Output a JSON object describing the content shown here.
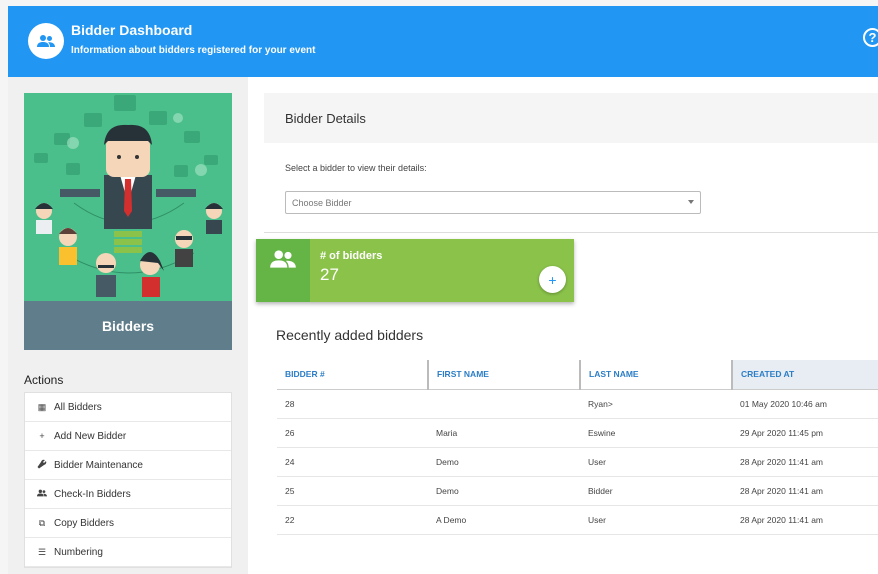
{
  "header": {
    "title": "Bidder Dashboard",
    "subtitle": "Information about bidders registered for your event",
    "help_glyph": "?",
    "icon": "people-icon"
  },
  "hero": {
    "caption": "Bidders"
  },
  "actions": {
    "title": "Actions",
    "items": [
      {
        "label": "All Bidders",
        "icon": "grid-icon",
        "glyph": "▦"
      },
      {
        "label": "Add New Bidder",
        "icon": "plus-icon",
        "glyph": "+"
      },
      {
        "label": "Bidder Maintenance",
        "icon": "wrench-icon",
        "glyph": "🔧"
      },
      {
        "label": "Check-In Bidders",
        "icon": "people-icon",
        "glyph": "👥"
      },
      {
        "label": "Copy Bidders",
        "icon": "copy-icon",
        "glyph": "⧉"
      },
      {
        "label": "Numbering",
        "icon": "list-icon",
        "glyph": "☰"
      }
    ]
  },
  "details": {
    "title": "Bidder Details",
    "select_label": "Select a bidder to view their details:",
    "select_placeholder": "Choose Bidder"
  },
  "stat": {
    "label": "# of bidders",
    "value": "27",
    "plus": "+"
  },
  "recent": {
    "title": "Recently added bidders",
    "columns": [
      "BIDDER #",
      "FIRST NAME",
      "LAST NAME",
      "CREATED AT"
    ],
    "rows": [
      [
        "28",
        "",
        "Ryan>",
        "01 May 2020 10:46 am"
      ],
      [
        "26",
        "Maria",
        "Eswine",
        "29 Apr 2020 11:45 pm"
      ],
      [
        "24",
        "Demo",
        "User",
        "28 Apr 2020 11:41 am"
      ],
      [
        "25",
        "Demo",
        "Bidder",
        "28 Apr 2020 11:41 am"
      ],
      [
        "22",
        "A Demo",
        "User",
        "28 Apr 2020 11:41 am"
      ]
    ]
  },
  "colors": {
    "header": "#2196f3",
    "hero_bg": "#4bbf8b",
    "caption_bg": "#607d8b",
    "stat_bg": "#8bc34a",
    "link": "#2b7dc6"
  }
}
